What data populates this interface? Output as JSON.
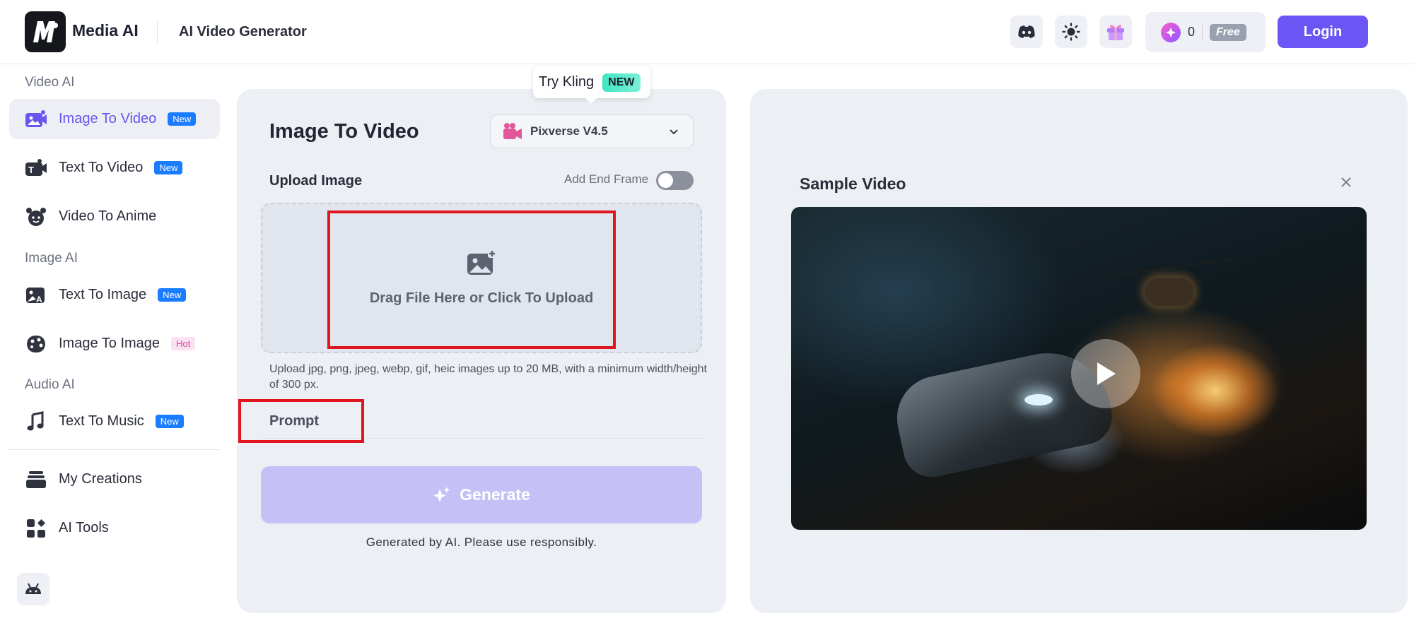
{
  "header": {
    "brand": "Media AI",
    "title": "AI Video Generator",
    "credits": "0",
    "plan": "Free",
    "login_label": "Login"
  },
  "sidebar": {
    "sections": [
      {
        "label": "Video AI"
      },
      {
        "label": "Image AI"
      },
      {
        "label": "Audio AI"
      }
    ],
    "items": [
      {
        "label": "Image To Video",
        "badge": "New",
        "icon": "image-to-video-icon"
      },
      {
        "label": "Text To Video",
        "badge": "New",
        "icon": "text-to-video-icon"
      },
      {
        "label": "Video To Anime",
        "badge": "",
        "icon": "anime-icon"
      },
      {
        "label": "Text To Image",
        "badge": "New",
        "icon": "text-to-image-icon"
      },
      {
        "label": "Image To Image",
        "badge": "Hot",
        "icon": "image-to-image-icon"
      },
      {
        "label": "Text To Music",
        "badge": "New",
        "icon": "music-icon"
      },
      {
        "label": "My Creations",
        "badge": "",
        "icon": "creations-icon"
      },
      {
        "label": "AI Tools",
        "badge": "",
        "icon": "tools-icon"
      }
    ]
  },
  "main": {
    "promo_text": "Try Kling",
    "promo_badge": "NEW",
    "title": "Image To Video",
    "model": "Pixverse V4.5",
    "upload_label": "Upload Image",
    "end_frame_label": "Add End Frame",
    "end_frame_on": false,
    "dropzone_text": "Drag File Here or Click To Upload",
    "upload_hint": "Upload jpg, png, jpeg, webp, gif, heic images up to 20 MB, with a minimum width/height of 300 px.",
    "prompt_label": "Prompt",
    "generate_label": "Generate",
    "disclaimer": "Generated by AI. Please use responsibly."
  },
  "sample": {
    "title": "Sample Video"
  },
  "colors": {
    "accent": "#6c55f5",
    "highlight": "#e0151d",
    "badge_new": "#1a7cff"
  }
}
